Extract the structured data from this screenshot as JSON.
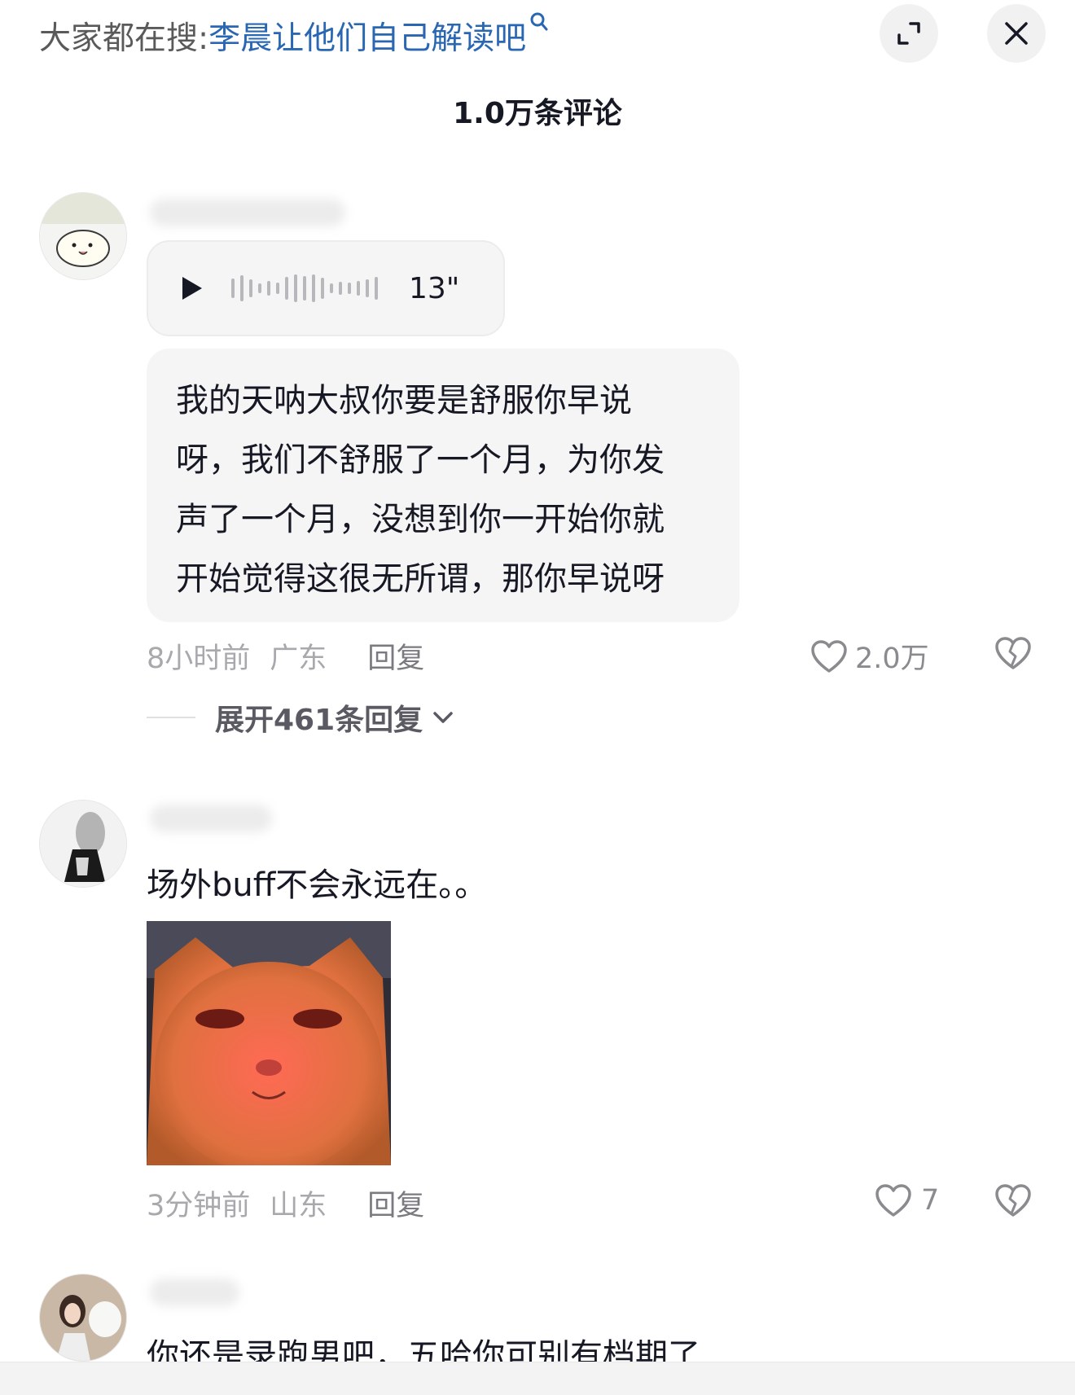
{
  "search": {
    "prefix": "大家都在搜:",
    "term": "李晨让他们自己解读吧"
  },
  "header": {
    "comment_count_title": "1.0万条评论",
    "expand_icon": "expand-icon",
    "close_icon": "close-icon"
  },
  "comments": [
    {
      "voice_duration": "13\"",
      "text_lines": [
        "我的天呐大叔你要是舒服你早说",
        "呀，我们不舒服了一个月，为你发",
        "声了一个月，没想到你一开始你就",
        "开始觉得这很无所谓，那你早说呀"
      ],
      "time": "8小时前",
      "location": "广东",
      "reply_label": "回复",
      "likes": "2.0万",
      "expand_replies": "展开461条回复"
    },
    {
      "text": "场外buff不会永远在。。",
      "time": "3分钟前",
      "location": "山东",
      "reply_label": "回复",
      "likes": "7"
    },
    {
      "text": "你还是录跑男吧，五哈你可别有档期了"
    }
  ]
}
